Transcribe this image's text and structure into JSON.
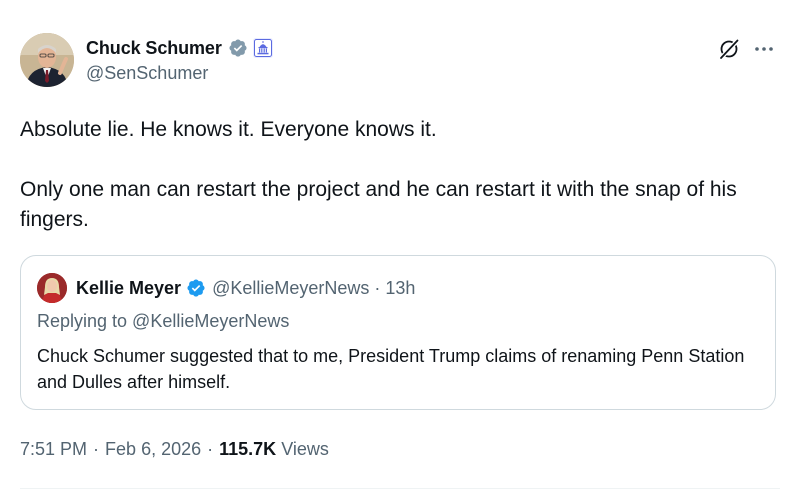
{
  "author": {
    "display_name": "Chuck Schumer",
    "handle": "@SenSchumer",
    "verified_badge_color": "#829aab",
    "gov_badge_color": "#5b6ae0"
  },
  "tweet": {
    "paragraphs": [
      "Absolute lie. He knows it. Everyone knows it.",
      "Only one man can restart the project and he can restart it with the snap of his fingers."
    ]
  },
  "quote": {
    "display_name": "Kellie Meyer",
    "handle": "@KellieMeyerNews",
    "separator": "·",
    "time": "13h",
    "replying_to": "Replying to @KellieMeyerNews",
    "text": "Chuck Schumer suggested that to me, President Trump claims of renaming Penn Station and Dulles after himself.",
    "verified_badge_color": "#1d9bf0"
  },
  "footer": {
    "time": "7:51 PM",
    "separator": "·",
    "date": "Feb 6, 2026",
    "views_count": "115.7K",
    "views_label": "Views"
  },
  "icons": {
    "grok": "grok-icon",
    "more": "more-icon"
  }
}
